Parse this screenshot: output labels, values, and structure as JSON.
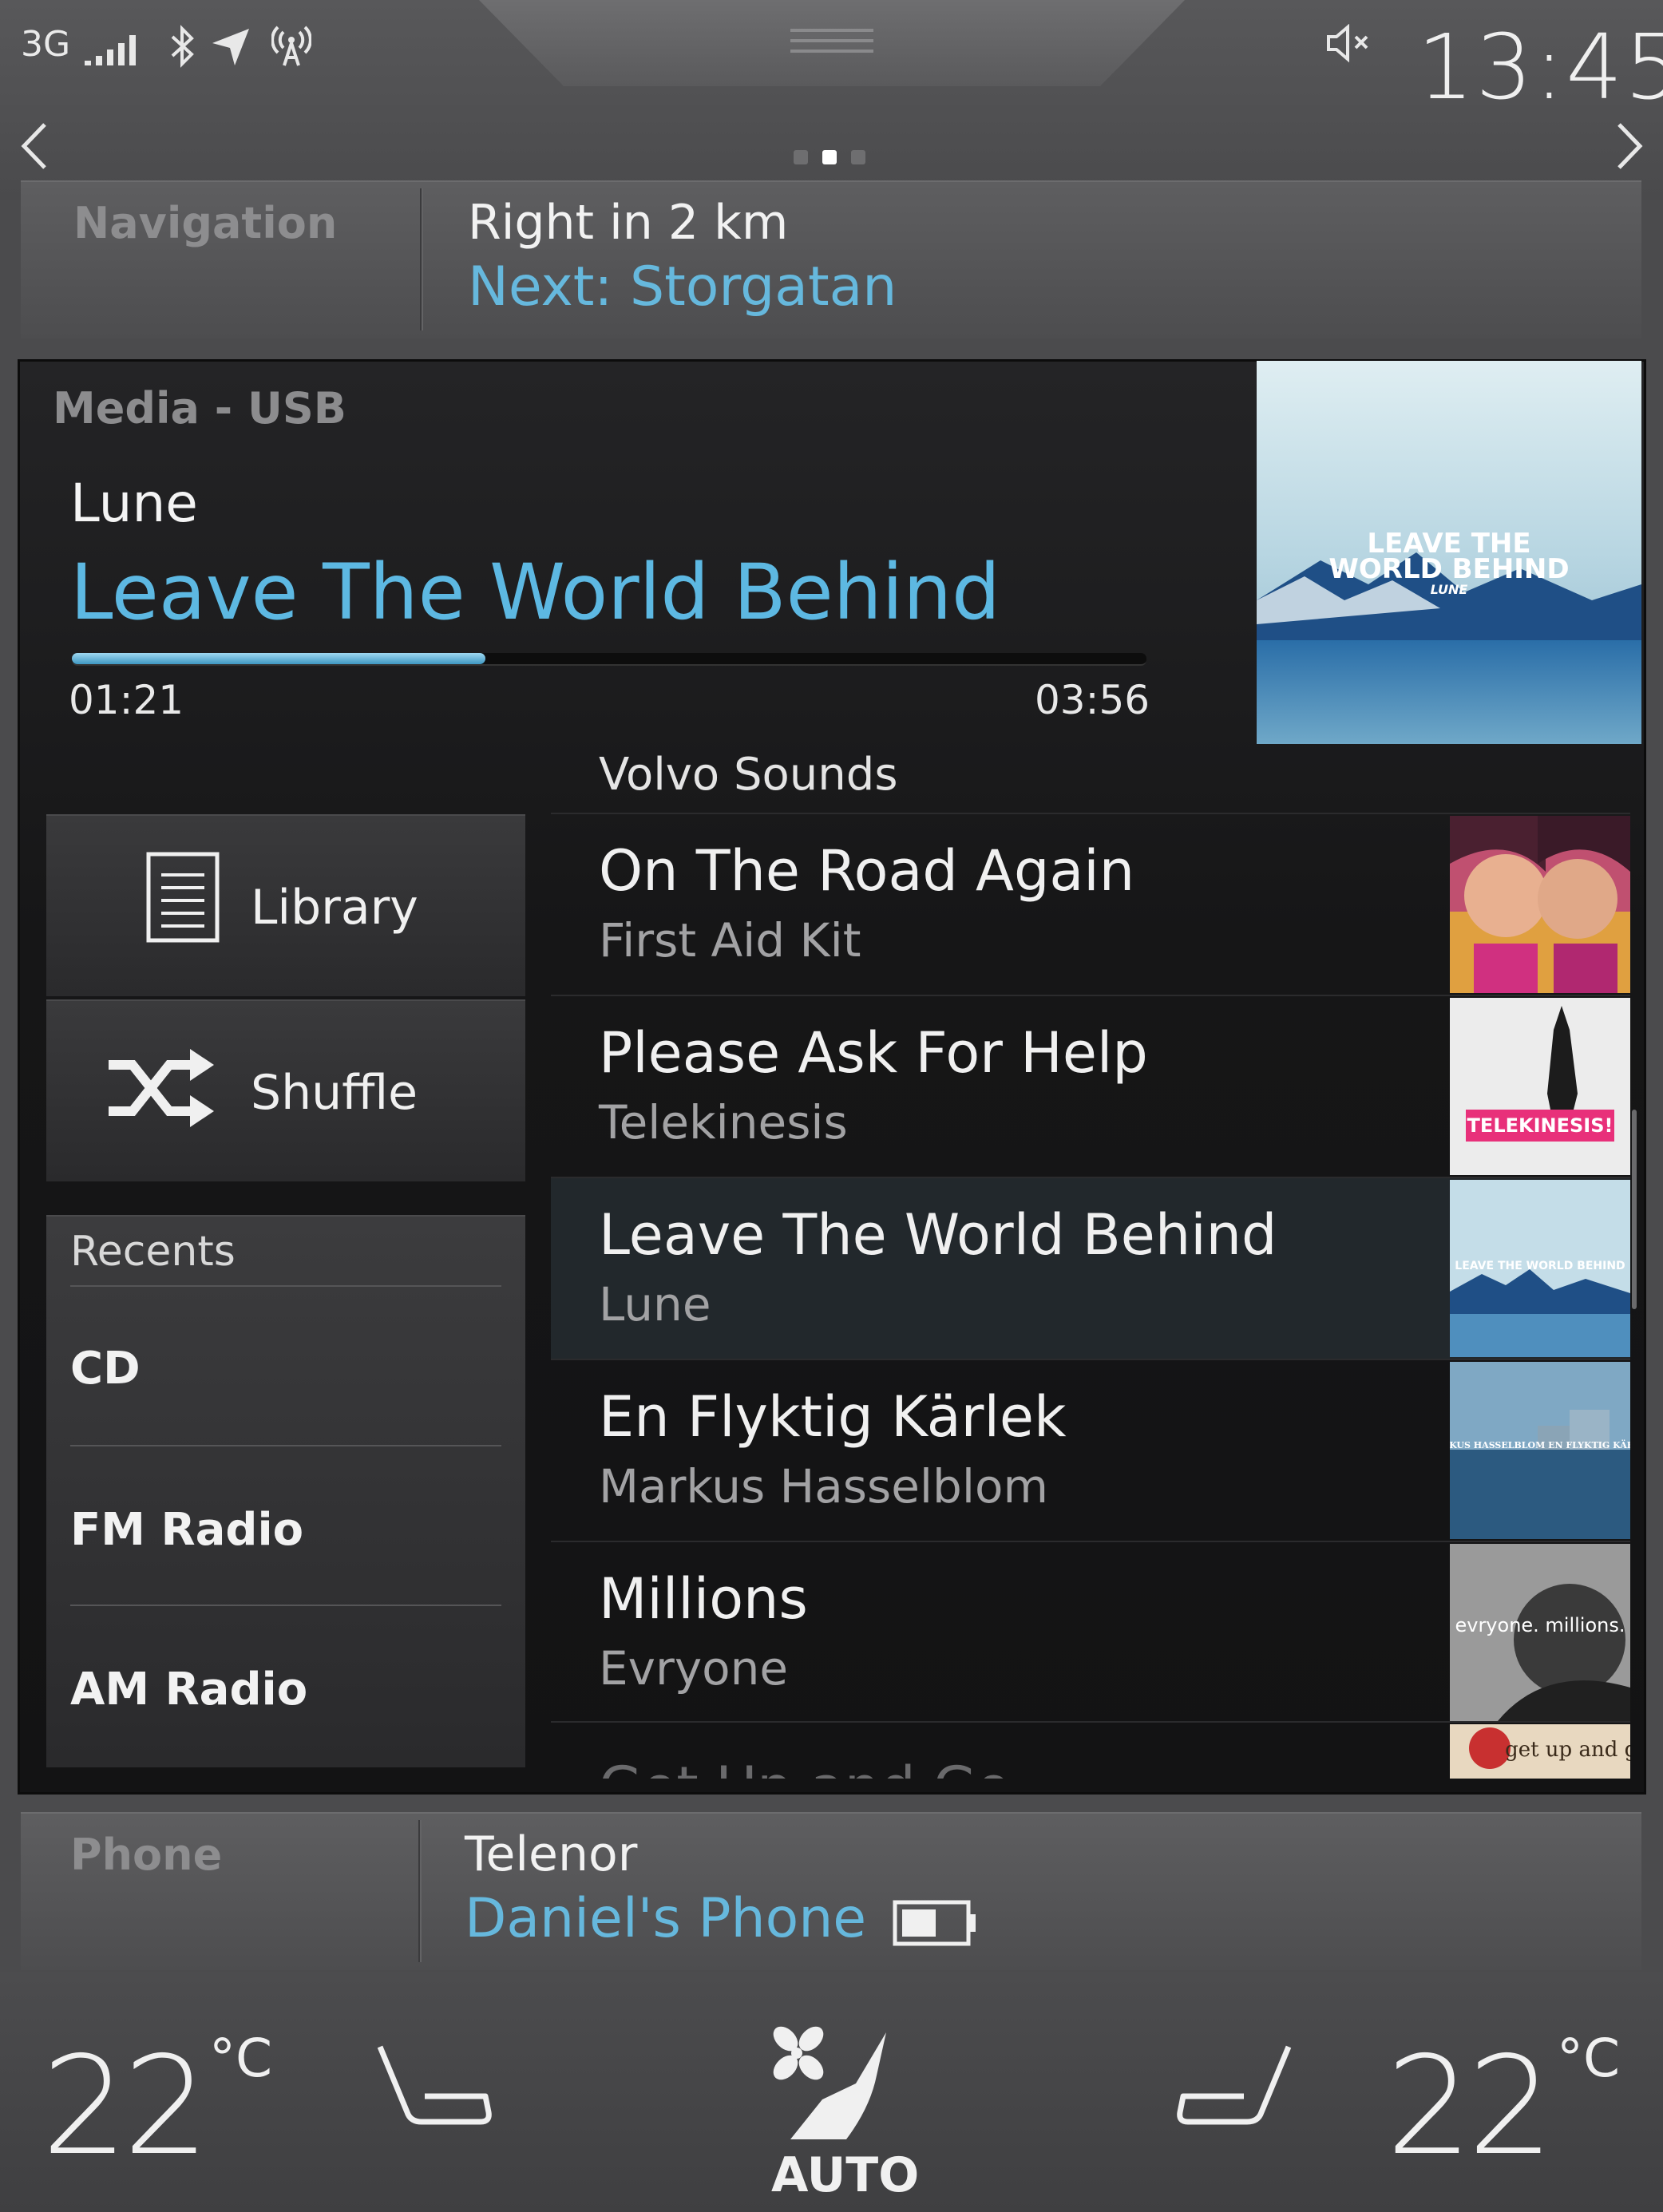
{
  "status_bar": {
    "network": "3G",
    "clock": "13:45",
    "icons": [
      "signal-bars-icon",
      "bluetooth-icon",
      "location-arrow-icon",
      "wifi-hotspot-icon",
      "speaker-muted-icon"
    ]
  },
  "pager": {
    "pages": 3,
    "current": 2
  },
  "navigation": {
    "title": "Navigation",
    "instruction": "Right in 2 km",
    "next": "Next: Storgatan"
  },
  "media": {
    "source": "Media - USB",
    "artist": "Lune",
    "song": "Leave The World Behind",
    "elapsed": "01:21",
    "total": "03:56",
    "progress": 0.385,
    "cover_text": [
      "LEAVE THE",
      "WORLD BEHIND",
      "LUNE"
    ]
  },
  "controls": {
    "library": "Library",
    "shuffle": "Shuffle"
  },
  "recents": {
    "title": "Recents",
    "items": [
      "CD",
      "FM Radio",
      "AM Radio"
    ]
  },
  "playlist": {
    "title": "Volvo Sounds",
    "tracks": [
      {
        "title": "On The Road Again",
        "artist": "First Aid Kit"
      },
      {
        "title": "Please Ask For Help",
        "artist": "Telekinesis",
        "cover_text": "TELEKINESIS!"
      },
      {
        "title": "Leave The World Behind",
        "artist": "Lune",
        "cover_text": "LEAVE THE WORLD BEHIND"
      },
      {
        "title": "En Flyktig Kärlek",
        "artist": "Markus Hasselblom",
        "cover_text": "MARKUS HASSELBLOM EN FLYKTIG KÄRLEK"
      },
      {
        "title": "Millions",
        "artist": "Evryone",
        "cover_text": "evryone. millions."
      }
    ],
    "partial_title": "Get Up and Go",
    "partial_cover_text": "get up and go",
    "active_index": 2
  },
  "phone": {
    "title": "Phone",
    "carrier": "Telenor",
    "device": "Daniel's Phone"
  },
  "climate": {
    "left_temp": "22",
    "right_temp": "22",
    "unit": "°C",
    "mode": "AUTO"
  },
  "colors": {
    "accent": "#5db8e2",
    "background": "#4b4b4d",
    "media_bg": "#161617"
  }
}
